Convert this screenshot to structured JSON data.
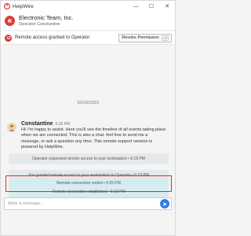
{
  "app": {
    "title": "HelpWire"
  },
  "window_controls": {
    "minimize": "—",
    "maximize": "☐",
    "close": "✕"
  },
  "header": {
    "company_name": "Electronic Team, Inc.",
    "operator_line": "Operator Constantine"
  },
  "status": {
    "text": "Remote access granted to Operator",
    "revoke_label": "Revoke Permission",
    "revoke_shortcut": "Alt",
    "status_color": "#d92f2f"
  },
  "chat": {
    "date": "10/16/2023",
    "message": {
      "sender": "Constantine",
      "time": "6:18 PM",
      "text": "Hi! I'm happy to assist. Here you'll see the timeline of all events taking place when we are connected. This is also a chat. feel free to send me a message, or ask a question any time. This remote support session is powered by HelpWire."
    },
    "events": [
      "Operator requested remote access to your workstation • 6:18 PM",
      "You granted remote access to your workstation to Operator • 6:19 PM",
      "Remote connection established • 6:19 PM",
      "Remote connection ended • 6:25 PM"
    ]
  },
  "input": {
    "placeholder": "Write a message..."
  },
  "colors": {
    "accent": "#2f7ee8",
    "brand": "#e03a2f",
    "highlight": "#d62c2c"
  }
}
